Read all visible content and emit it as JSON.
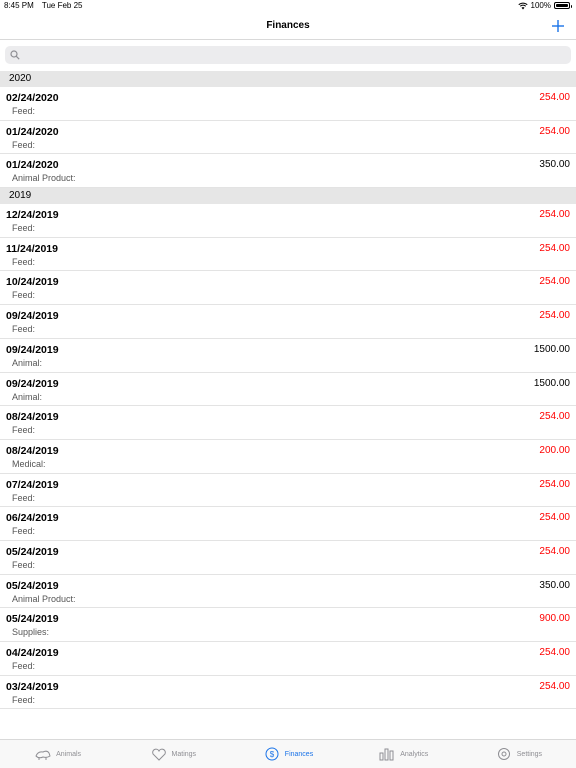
{
  "status": {
    "time": "8:45 PM",
    "date": "Tue Feb 25",
    "battery": "100%"
  },
  "nav": {
    "title": "Finances"
  },
  "search": {
    "placeholder": ""
  },
  "colors": {
    "accent": "#1a73e8",
    "expense": "#ff0000",
    "income": "#000000"
  },
  "sections": [
    {
      "year": "2020",
      "rows": [
        {
          "date": "02/24/2020",
          "category": "Feed:",
          "amount": "254.00",
          "kind": "expense"
        },
        {
          "date": "01/24/2020",
          "category": "Feed:",
          "amount": "254.00",
          "kind": "expense"
        },
        {
          "date": "01/24/2020",
          "category": "Animal Product:",
          "amount": "350.00",
          "kind": "income"
        }
      ]
    },
    {
      "year": "2019",
      "rows": [
        {
          "date": "12/24/2019",
          "category": "Feed:",
          "amount": "254.00",
          "kind": "expense"
        },
        {
          "date": "11/24/2019",
          "category": "Feed:",
          "amount": "254.00",
          "kind": "expense"
        },
        {
          "date": "10/24/2019",
          "category": "Feed:",
          "amount": "254.00",
          "kind": "expense"
        },
        {
          "date": "09/24/2019",
          "category": "Feed:",
          "amount": "254.00",
          "kind": "expense"
        },
        {
          "date": "09/24/2019",
          "category": "Animal:",
          "amount": "1500.00",
          "kind": "income"
        },
        {
          "date": "09/24/2019",
          "category": "Animal:",
          "amount": "1500.00",
          "kind": "income"
        },
        {
          "date": "08/24/2019",
          "category": "Feed:",
          "amount": "254.00",
          "kind": "expense"
        },
        {
          "date": "08/24/2019",
          "category": "Medical:",
          "amount": "200.00",
          "kind": "expense"
        },
        {
          "date": "07/24/2019",
          "category": "Feed:",
          "amount": "254.00",
          "kind": "expense"
        },
        {
          "date": "06/24/2019",
          "category": "Feed:",
          "amount": "254.00",
          "kind": "expense"
        },
        {
          "date": "05/24/2019",
          "category": "Feed:",
          "amount": "254.00",
          "kind": "expense"
        },
        {
          "date": "05/24/2019",
          "category": "Animal Product:",
          "amount": "350.00",
          "kind": "income"
        },
        {
          "date": "05/24/2019",
          "category": "Supplies:",
          "amount": "900.00",
          "kind": "expense"
        },
        {
          "date": "04/24/2019",
          "category": "Feed:",
          "amount": "254.00",
          "kind": "expense"
        },
        {
          "date": "03/24/2019",
          "category": "Feed:",
          "amount": "254.00",
          "kind": "expense"
        }
      ]
    }
  ],
  "tabs": [
    {
      "label": "Animals",
      "icon": "animals-icon",
      "active": false
    },
    {
      "label": "Matings",
      "icon": "heart-icon",
      "active": false
    },
    {
      "label": "Finances",
      "icon": "dollar-icon",
      "active": true
    },
    {
      "label": "Analytics",
      "icon": "bar-chart-icon",
      "active": false
    },
    {
      "label": "Settings",
      "icon": "gear-icon",
      "active": false
    }
  ]
}
